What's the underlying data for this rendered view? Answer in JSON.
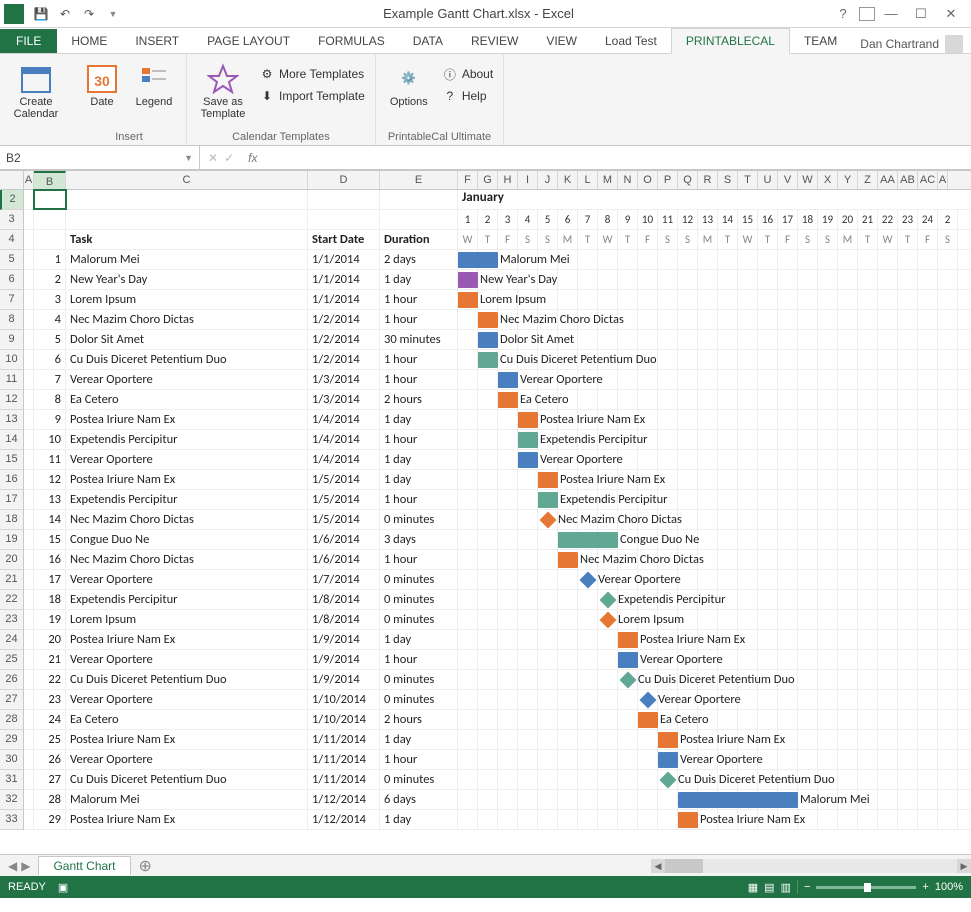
{
  "title": "Example Gantt Chart.xlsx - Excel",
  "account_name": "Dan Chartrand",
  "tabs": [
    "FILE",
    "HOME",
    "INSERT",
    "PAGE LAYOUT",
    "FORMULAS",
    "DATA",
    "REVIEW",
    "VIEW",
    "Load Test",
    "PRINTABLECAL",
    "TEAM"
  ],
  "active_tab": "PRINTABLECAL",
  "ribbon": {
    "create_calendar": "Create\nCalendar",
    "date": "Date",
    "legend": "Legend",
    "insert_group": "Insert",
    "save_as_template": "Save as\nTemplate",
    "more_templates": "More Templates",
    "import_template": "Import Template",
    "calendar_templates_group": "Calendar Templates",
    "options": "Options",
    "about": "About",
    "help": "Help",
    "ultimate_group": "PrintableCal Ultimate"
  },
  "name_box": "B2",
  "sheet_tab": "Gantt Chart",
  "status_ready": "READY",
  "zoom_pct": "100%",
  "columns": {
    "headers": [
      "A",
      "B",
      "C",
      "D",
      "E",
      "F",
      "G",
      "H",
      "I",
      "J",
      "K",
      "L",
      "M",
      "N",
      "O",
      "P",
      "Q",
      "R",
      "S",
      "T",
      "U",
      "V",
      "W",
      "X",
      "Y",
      "Z",
      "AA",
      "AB",
      "AC",
      "A"
    ]
  },
  "month_label": "January",
  "day_nums": [
    "1",
    "2",
    "3",
    "4",
    "5",
    "6",
    "7",
    "8",
    "9",
    "10",
    "11",
    "12",
    "13",
    "14",
    "15",
    "16",
    "17",
    "18",
    "19",
    "20",
    "21",
    "22",
    "23",
    "24",
    "2"
  ],
  "day_weeks": [
    "W",
    "T",
    "F",
    "S",
    "S",
    "M",
    "T",
    "W",
    "T",
    "F",
    "S",
    "S",
    "M",
    "T",
    "W",
    "T",
    "F",
    "S",
    "S",
    "M",
    "T",
    "W",
    "T",
    "F",
    "S"
  ],
  "head": {
    "task": "Task",
    "start": "Start Date",
    "duration": "Duration"
  },
  "colors": {
    "blue": "#4a7fbf",
    "purple": "#9b59b6",
    "orange": "#e67634",
    "teal": "#60a893"
  },
  "rows": [
    {
      "n": 1,
      "task": "Malorum Mei",
      "start": "1/1/2014",
      "dur": "2 days",
      "bar_start": 0,
      "bar_len": 2,
      "color": "blue"
    },
    {
      "n": 2,
      "task": "New Year's Day",
      "start": "1/1/2014",
      "dur": "1 day",
      "bar_start": 0,
      "bar_len": 1,
      "color": "purple"
    },
    {
      "n": 3,
      "task": "Lorem Ipsum",
      "start": "1/1/2014",
      "dur": "1 hour",
      "bar_start": 0,
      "bar_len": 1,
      "color": "orange"
    },
    {
      "n": 4,
      "task": "Nec Mazim Choro Dictas",
      "start": "1/2/2014",
      "dur": "1 hour",
      "bar_start": 1,
      "bar_len": 1,
      "color": "orange"
    },
    {
      "n": 5,
      "task": "Dolor Sit Amet",
      "start": "1/2/2014",
      "dur": "30 minutes",
      "bar_start": 1,
      "bar_len": 1,
      "color": "blue"
    },
    {
      "n": 6,
      "task": "Cu Duis Diceret Petentium Duo",
      "start": "1/2/2014",
      "dur": "1 hour",
      "bar_start": 1,
      "bar_len": 1,
      "color": "teal"
    },
    {
      "n": 7,
      "task": "Verear Oportere",
      "start": "1/3/2014",
      "dur": "1 hour",
      "bar_start": 2,
      "bar_len": 1,
      "color": "blue"
    },
    {
      "n": 8,
      "task": "Ea Cetero",
      "start": "1/3/2014",
      "dur": "2 hours",
      "bar_start": 2,
      "bar_len": 1,
      "color": "orange"
    },
    {
      "n": 9,
      "task": "Postea Iriure Nam Ex",
      "start": "1/4/2014",
      "dur": "1 day",
      "bar_start": 3,
      "bar_len": 1,
      "color": "orange"
    },
    {
      "n": 10,
      "task": "Expetendis Percipitur",
      "start": "1/4/2014",
      "dur": "1 hour",
      "bar_start": 3,
      "bar_len": 1,
      "color": "teal"
    },
    {
      "n": 11,
      "task": "Verear Oportere",
      "start": "1/4/2014",
      "dur": "1 day",
      "bar_start": 3,
      "bar_len": 1,
      "color": "blue"
    },
    {
      "n": 12,
      "task": "Postea Iriure Nam Ex",
      "start": "1/5/2014",
      "dur": "1 day",
      "bar_start": 4,
      "bar_len": 1,
      "color": "orange"
    },
    {
      "n": 13,
      "task": "Expetendis Percipitur",
      "start": "1/5/2014",
      "dur": "1 hour",
      "bar_start": 4,
      "bar_len": 1,
      "color": "teal"
    },
    {
      "n": 14,
      "task": "Nec Mazim Choro Dictas",
      "start": "1/5/2014",
      "dur": "0 minutes",
      "bar_start": 4,
      "bar_len": 0,
      "color": "orange",
      "milestone": true
    },
    {
      "n": 15,
      "task": "Congue Duo Ne",
      "start": "1/6/2014",
      "dur": "3 days",
      "bar_start": 5,
      "bar_len": 3,
      "color": "teal"
    },
    {
      "n": 16,
      "task": "Nec Mazim Choro Dictas",
      "start": "1/6/2014",
      "dur": "1 hour",
      "bar_start": 5,
      "bar_len": 1,
      "color": "orange"
    },
    {
      "n": 17,
      "task": "Verear Oportere",
      "start": "1/7/2014",
      "dur": "0 minutes",
      "bar_start": 6,
      "bar_len": 0,
      "color": "blue",
      "milestone": true
    },
    {
      "n": 18,
      "task": "Expetendis Percipitur",
      "start": "1/8/2014",
      "dur": "0 minutes",
      "bar_start": 7,
      "bar_len": 0,
      "color": "teal",
      "milestone": true
    },
    {
      "n": 19,
      "task": "Lorem Ipsum",
      "start": "1/8/2014",
      "dur": "0 minutes",
      "bar_start": 7,
      "bar_len": 0,
      "color": "orange",
      "milestone": true
    },
    {
      "n": 20,
      "task": "Postea Iriure Nam Ex",
      "start": "1/9/2014",
      "dur": "1 day",
      "bar_start": 8,
      "bar_len": 1,
      "color": "orange"
    },
    {
      "n": 21,
      "task": "Verear Oportere",
      "start": "1/9/2014",
      "dur": "1 hour",
      "bar_start": 8,
      "bar_len": 1,
      "color": "blue"
    },
    {
      "n": 22,
      "task": "Cu Duis Diceret Petentium Duo",
      "start": "1/9/2014",
      "dur": "0 minutes",
      "bar_start": 8,
      "bar_len": 0,
      "color": "teal",
      "milestone": true
    },
    {
      "n": 23,
      "task": "Verear Oportere",
      "start": "1/10/2014",
      "dur": "0 minutes",
      "bar_start": 9,
      "bar_len": 0,
      "color": "blue",
      "milestone": true
    },
    {
      "n": 24,
      "task": "Ea Cetero",
      "start": "1/10/2014",
      "dur": "2 hours",
      "bar_start": 9,
      "bar_len": 1,
      "color": "orange"
    },
    {
      "n": 25,
      "task": "Postea Iriure Nam Ex",
      "start": "1/11/2014",
      "dur": "1 day",
      "bar_start": 10,
      "bar_len": 1,
      "color": "orange"
    },
    {
      "n": 26,
      "task": "Verear Oportere",
      "start": "1/11/2014",
      "dur": "1 hour",
      "bar_start": 10,
      "bar_len": 1,
      "color": "blue"
    },
    {
      "n": 27,
      "task": "Cu Duis Diceret Petentium Duo",
      "start": "1/11/2014",
      "dur": "0 minutes",
      "bar_start": 10,
      "bar_len": 0,
      "color": "teal",
      "milestone": true
    },
    {
      "n": 28,
      "task": "Malorum Mei",
      "start": "1/12/2014",
      "dur": "6 days",
      "bar_start": 11,
      "bar_len": 6,
      "color": "blue"
    },
    {
      "n": 29,
      "task": "Postea Iriure Nam Ex",
      "start": "1/12/2014",
      "dur": "1 day",
      "bar_start": 11,
      "bar_len": 1,
      "color": "orange"
    }
  ],
  "chart_data": {
    "type": "gantt",
    "title": "Example Gantt Chart",
    "x_axis": "January 2014 (days 1-24 visible)",
    "tasks": [
      {
        "id": 1,
        "name": "Malorum Mei",
        "start": "2014-01-01",
        "duration_days": 2,
        "category": "blue"
      },
      {
        "id": 2,
        "name": "New Year's Day",
        "start": "2014-01-01",
        "duration_days": 1,
        "category": "purple"
      },
      {
        "id": 3,
        "name": "Lorem Ipsum",
        "start": "2014-01-01",
        "duration_hours": 1,
        "category": "orange"
      },
      {
        "id": 4,
        "name": "Nec Mazim Choro Dictas",
        "start": "2014-01-02",
        "duration_hours": 1,
        "category": "orange"
      },
      {
        "id": 5,
        "name": "Dolor Sit Amet",
        "start": "2014-01-02",
        "duration_minutes": 30,
        "category": "blue"
      },
      {
        "id": 6,
        "name": "Cu Duis Diceret Petentium Duo",
        "start": "2014-01-02",
        "duration_hours": 1,
        "category": "teal"
      },
      {
        "id": 7,
        "name": "Verear Oportere",
        "start": "2014-01-03",
        "duration_hours": 1,
        "category": "blue"
      },
      {
        "id": 8,
        "name": "Ea Cetero",
        "start": "2014-01-03",
        "duration_hours": 2,
        "category": "orange"
      },
      {
        "id": 9,
        "name": "Postea Iriure Nam Ex",
        "start": "2014-01-04",
        "duration_days": 1,
        "category": "orange"
      },
      {
        "id": 10,
        "name": "Expetendis Percipitur",
        "start": "2014-01-04",
        "duration_hours": 1,
        "category": "teal"
      },
      {
        "id": 11,
        "name": "Verear Oportere",
        "start": "2014-01-04",
        "duration_days": 1,
        "category": "blue"
      },
      {
        "id": 12,
        "name": "Postea Iriure Nam Ex",
        "start": "2014-01-05",
        "duration_days": 1,
        "category": "orange"
      },
      {
        "id": 13,
        "name": "Expetendis Percipitur",
        "start": "2014-01-05",
        "duration_hours": 1,
        "category": "teal"
      },
      {
        "id": 14,
        "name": "Nec Mazim Choro Dictas",
        "start": "2014-01-05",
        "duration_minutes": 0,
        "milestone": true,
        "category": "orange"
      },
      {
        "id": 15,
        "name": "Congue Duo Ne",
        "start": "2014-01-06",
        "duration_days": 3,
        "category": "teal"
      },
      {
        "id": 16,
        "name": "Nec Mazim Choro Dictas",
        "start": "2014-01-06",
        "duration_hours": 1,
        "category": "orange"
      },
      {
        "id": 17,
        "name": "Verear Oportere",
        "start": "2014-01-07",
        "duration_minutes": 0,
        "milestone": true,
        "category": "blue"
      },
      {
        "id": 18,
        "name": "Expetendis Percipitur",
        "start": "2014-01-08",
        "duration_minutes": 0,
        "milestone": true,
        "category": "teal"
      },
      {
        "id": 19,
        "name": "Lorem Ipsum",
        "start": "2014-01-08",
        "duration_minutes": 0,
        "milestone": true,
        "category": "orange"
      },
      {
        "id": 20,
        "name": "Postea Iriure Nam Ex",
        "start": "2014-01-09",
        "duration_days": 1,
        "category": "orange"
      },
      {
        "id": 21,
        "name": "Verear Oportere",
        "start": "2014-01-09",
        "duration_hours": 1,
        "category": "blue"
      },
      {
        "id": 22,
        "name": "Cu Duis Diceret Petentium Duo",
        "start": "2014-01-09",
        "duration_minutes": 0,
        "milestone": true,
        "category": "teal"
      },
      {
        "id": 23,
        "name": "Verear Oportere",
        "start": "2014-01-10",
        "duration_minutes": 0,
        "milestone": true,
        "category": "blue"
      },
      {
        "id": 24,
        "name": "Ea Cetero",
        "start": "2014-01-10",
        "duration_hours": 2,
        "category": "orange"
      },
      {
        "id": 25,
        "name": "Postea Iriure Nam Ex",
        "start": "2014-01-11",
        "duration_days": 1,
        "category": "orange"
      },
      {
        "id": 26,
        "name": "Verear Oportere",
        "start": "2014-01-11",
        "duration_hours": 1,
        "category": "blue"
      },
      {
        "id": 27,
        "name": "Cu Duis Diceret Petentium Duo",
        "start": "2014-01-11",
        "duration_minutes": 0,
        "milestone": true,
        "category": "teal"
      },
      {
        "id": 28,
        "name": "Malorum Mei",
        "start": "2014-01-12",
        "duration_days": 6,
        "category": "blue"
      },
      {
        "id": 29,
        "name": "Postea Iriure Nam Ex",
        "start": "2014-01-12",
        "duration_days": 1,
        "category": "orange"
      }
    ]
  }
}
